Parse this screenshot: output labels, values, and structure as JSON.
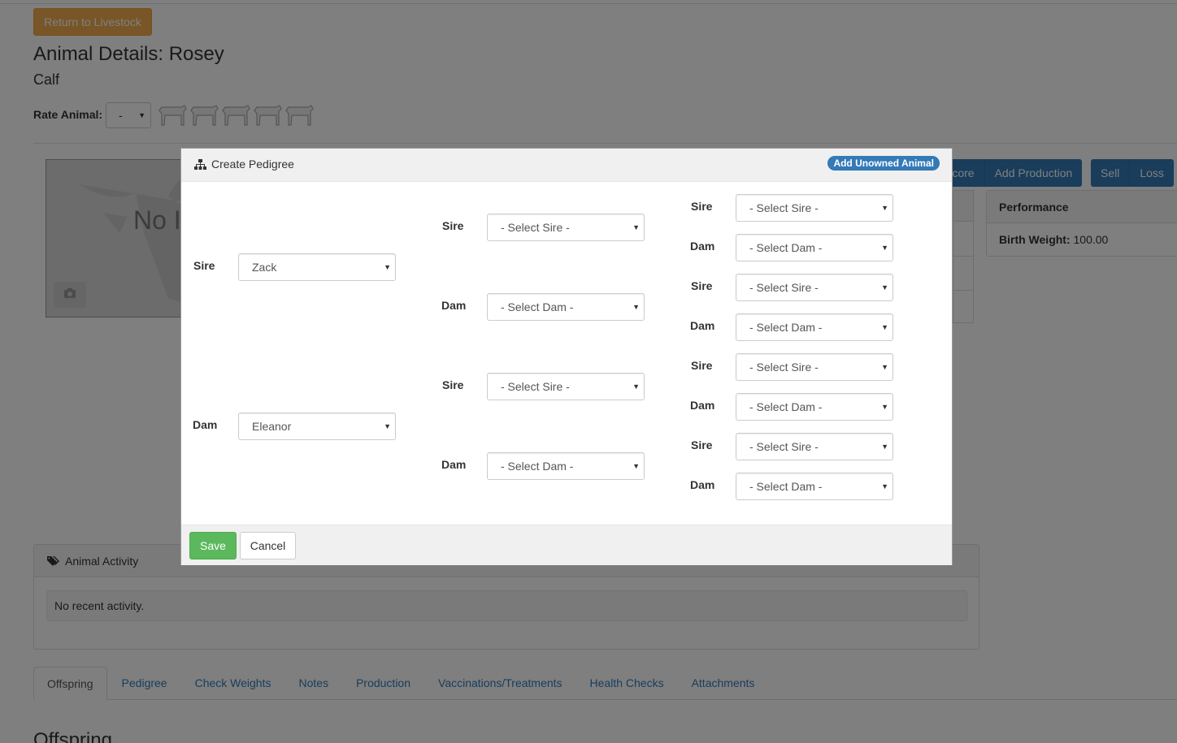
{
  "page": {
    "return_button": "Return to Livestock",
    "title": "Animal Details: Rosey",
    "subtitle": "Calf",
    "rate_label": "Rate Animal:",
    "rate_value": "-",
    "photo_text": "No Image Available",
    "actions_visible": [
      "Score",
      "Add Production"
    ],
    "actions_right": [
      "Sell",
      "Loss"
    ],
    "performance": {
      "title": "Performance",
      "birth_weight_label": "Birth Weight:",
      "birth_weight_value": "100.00"
    },
    "activity": {
      "title": "Animal Activity",
      "empty": "No recent activity."
    },
    "tabs": [
      "Offspring",
      "Pedigree",
      "Check Weights",
      "Notes",
      "Production",
      "Vaccinations/Treatments",
      "Health Checks",
      "Attachments"
    ],
    "active_tab": "Offspring",
    "section_heading": "Offspring"
  },
  "modal": {
    "title": "Create Pedigree",
    "add_badge": "Add Unowned Animal",
    "gen1": [
      {
        "label": "Sire",
        "value": "Zack"
      },
      {
        "label": "Dam",
        "value": "Eleanor"
      }
    ],
    "gen2": [
      {
        "label": "Sire",
        "value": "- Select Sire -"
      },
      {
        "label": "Dam",
        "value": "- Select Dam -"
      },
      {
        "label": "Sire",
        "value": "- Select Sire -"
      },
      {
        "label": "Dam",
        "value": "- Select Dam -"
      }
    ],
    "gen3": [
      {
        "label": "Sire",
        "value": "- Select Sire -"
      },
      {
        "label": "Dam",
        "value": "- Select Dam -"
      },
      {
        "label": "Sire",
        "value": "- Select Sire -"
      },
      {
        "label": "Dam",
        "value": "- Select Dam -"
      },
      {
        "label": "Sire",
        "value": "- Select Sire -"
      },
      {
        "label": "Dam",
        "value": "- Select Dam -"
      },
      {
        "label": "Sire",
        "value": "- Select Sire -"
      },
      {
        "label": "Dam",
        "value": "- Select Dam -"
      }
    ],
    "save_label": "Save",
    "cancel_label": "Cancel"
  }
}
